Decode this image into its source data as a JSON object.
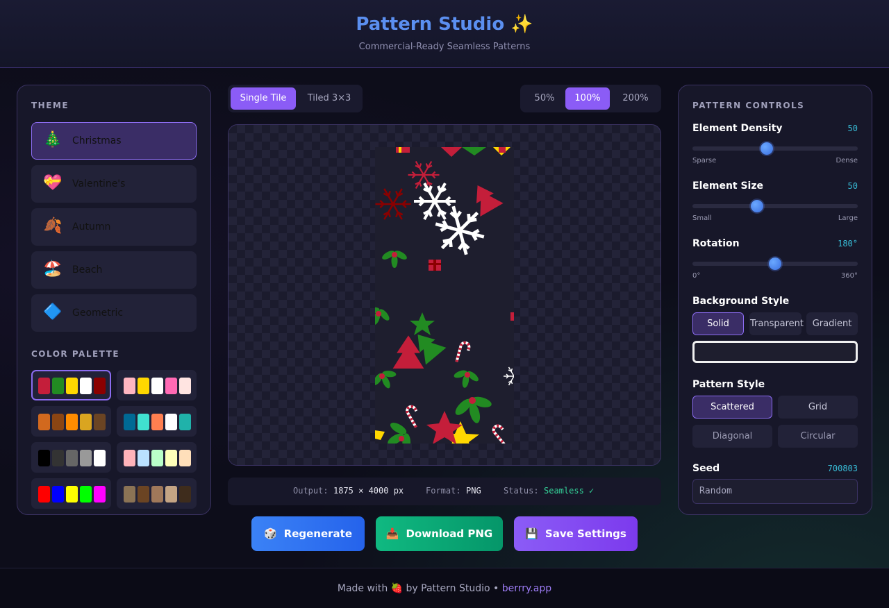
{
  "header": {
    "title": "Pattern Studio ✨",
    "subtitle": "Commercial-Ready Seamless Patterns"
  },
  "theme_panel": {
    "label": "THEME",
    "items": [
      {
        "icon": "🎄",
        "label": "Christmas",
        "active": true
      },
      {
        "icon": "💝",
        "label": "Valentine's",
        "active": false
      },
      {
        "icon": "🍂",
        "label": "Autumn",
        "active": false
      },
      {
        "icon": "🏖️",
        "label": "Beach",
        "active": false
      },
      {
        "icon": "🔷",
        "label": "Geometric",
        "active": false
      }
    ],
    "palette_label": "COLOR PALETTE",
    "palettes": [
      [
        "#c41e3a",
        "#228b22",
        "#ffd700",
        "#ffffff",
        "#8b0000"
      ],
      [
        "#ffb6c1",
        "#ffd700",
        "#ffffff",
        "#ff69b4",
        "#ffe4e1"
      ],
      [
        "#d2691e",
        "#8b4513",
        "#ff8c00",
        "#daa520",
        "#6b4423"
      ],
      [
        "#006994",
        "#40e0d0",
        "#ff7f50",
        "#ffffff",
        "#20b2aa"
      ],
      [
        "#000000",
        "#333333",
        "#666666",
        "#999999",
        "#ffffff"
      ],
      [
        "#ffb3ba",
        "#bae1ff",
        "#baffc9",
        "#ffffba",
        "#ffdfba"
      ],
      [
        "#ff0000",
        "#0000ff",
        "#ffff00",
        "#00ff00",
        "#ff00ff"
      ],
      [
        "#8b7355",
        "#6b4423",
        "#a0785a",
        "#c4a484",
        "#3e2c1c"
      ]
    ]
  },
  "view_mode": {
    "options": [
      "Single Tile",
      "Tiled 3×3"
    ],
    "selected": "Single Tile"
  },
  "zoom": {
    "options": [
      "50%",
      "100%",
      "200%"
    ],
    "selected": "100%"
  },
  "info": {
    "output_label": "Output:",
    "output_value": "1875 × 4000 px",
    "format_label": "Format:",
    "format_value": "PNG",
    "status_label": "Status:",
    "status_value": "Seamless ✓"
  },
  "actions": {
    "regenerate": {
      "icon": "🎲",
      "label": "Regenerate"
    },
    "download": {
      "icon": "📥",
      "label": "Download PNG"
    },
    "save": {
      "icon": "💾",
      "label": "Save Settings"
    }
  },
  "controls": {
    "label": "PATTERN CONTROLS",
    "density": {
      "title": "Element Density",
      "value": "50",
      "level": 0.45,
      "min_label": "Sparse",
      "max_label": "Dense"
    },
    "size": {
      "title": "Element Size",
      "value": "50",
      "level": 0.39,
      "min_label": "Small",
      "max_label": "Large"
    },
    "rotation": {
      "title": "Rotation",
      "value": "180°",
      "level": 0.5,
      "min_label": "0°",
      "max_label": "360°"
    },
    "background": {
      "title": "Background Style",
      "options": [
        "Solid",
        "Transparent",
        "Gradient"
      ],
      "selected": "Solid",
      "color": "#1e1e2e"
    },
    "pattern_style": {
      "title": "Pattern Style",
      "options": [
        "Scattered",
        "Grid",
        "Diagonal",
        "Circular"
      ],
      "selected": "Scattered"
    },
    "seed": {
      "title": "Seed",
      "value": "700803",
      "placeholder": "Random"
    }
  },
  "footer": {
    "text": "Made with 🍓 by Pattern Studio •",
    "link": "berrry.app"
  }
}
